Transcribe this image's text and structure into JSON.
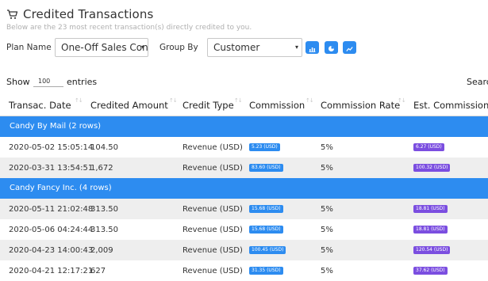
{
  "header": {
    "title": "Credited Transactions",
    "subtitle": "Below are the 23 most recent transaction(s) directly credited to you."
  },
  "filters": {
    "plan_label": "Plan Name",
    "plan_value": "One-Off Sales Cont",
    "group_label": "Group By",
    "group_value": "Customer",
    "buttons": [
      "bar-chart-icon",
      "pie-chart-icon",
      "line-chart-icon"
    ]
  },
  "table_controls": {
    "show_label": "Show",
    "page_length": "100",
    "entries_label": "entries",
    "search_label": "Search"
  },
  "table": {
    "columns": [
      "Transac. Date",
      "Credited Amount",
      "Credit Type",
      "Commission",
      "Commission Rate",
      "Est. Commission"
    ],
    "groups": [
      {
        "label": "Candy By Mail (2 rows)",
        "rows": [
          {
            "date": "2020-05-02 15:05:14",
            "amount": "104.50",
            "type": "Revenue (USD)",
            "commission": "5.23 (USD)",
            "rate": "5%",
            "est": "6.27 (USD)"
          },
          {
            "date": "2020-03-31 13:54:51",
            "amount": "1,672",
            "type": "Revenue (USD)",
            "commission": "83.60 (USD)",
            "rate": "5%",
            "est": "100.32 (USD)"
          }
        ]
      },
      {
        "label": "Candy Fancy Inc. (4 rows)",
        "rows": [
          {
            "date": "2020-05-11 21:02:48",
            "amount": "313.50",
            "type": "Revenue (USD)",
            "commission": "15.68 (USD)",
            "rate": "5%",
            "est": "18.81 (USD)"
          },
          {
            "date": "2020-05-06 04:24:44",
            "amount": "313.50",
            "type": "Revenue (USD)",
            "commission": "15.68 (USD)",
            "rate": "5%",
            "est": "18.81 (USD)"
          },
          {
            "date": "2020-04-23 14:00:43",
            "amount": "2,009",
            "type": "Revenue (USD)",
            "commission": "100.45 (USD)",
            "rate": "5%",
            "est": "120.54 (USD)"
          },
          {
            "date": "2020-04-21 12:17:21",
            "amount": "627",
            "type": "Revenue (USD)",
            "commission": "31.35 (USD)",
            "rate": "5%",
            "est": "37.62 (USD)"
          }
        ]
      }
    ]
  },
  "colors": {
    "accent": "#2d8cf0",
    "est_badge": "#7b4ee0",
    "row_alt": "#eeeeee"
  }
}
